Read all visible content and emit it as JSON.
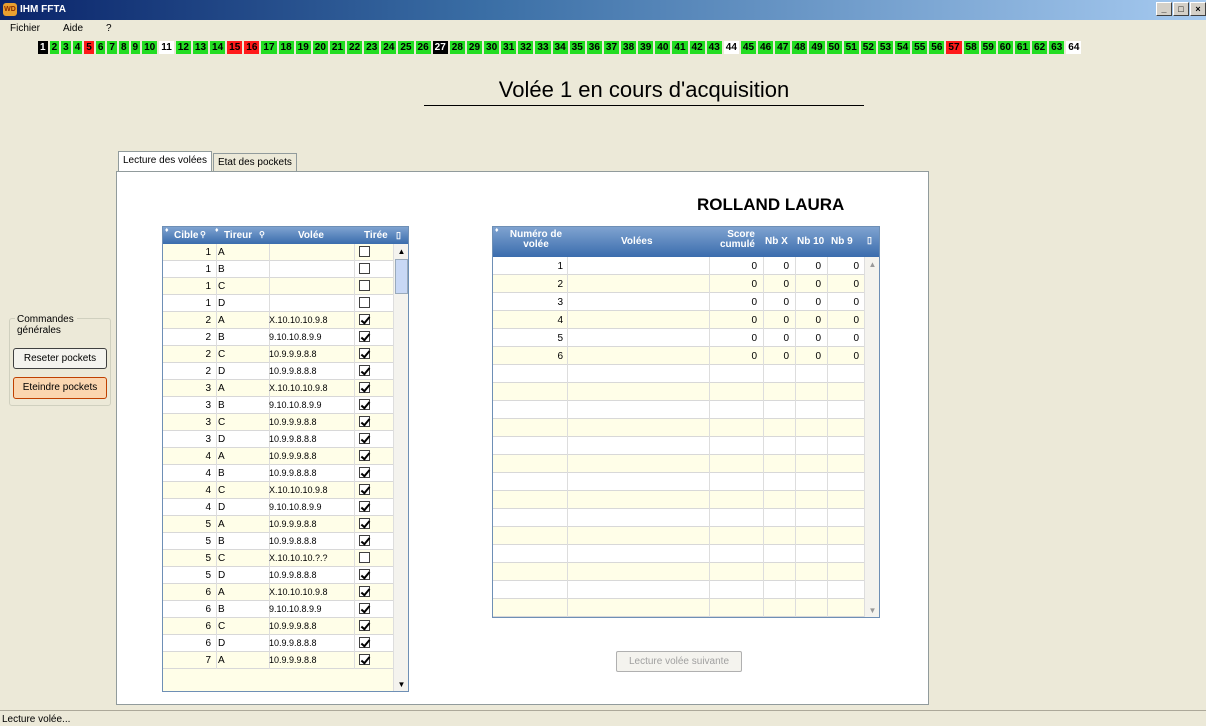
{
  "window": {
    "title": "IHM FFTA",
    "icon_text": "WD"
  },
  "menu": [
    "Fichier",
    "Aide",
    "?"
  ],
  "targets": [
    {
      "n": "1",
      "s": "black"
    },
    {
      "n": "2",
      "s": "green"
    },
    {
      "n": "3",
      "s": "green"
    },
    {
      "n": "4",
      "s": "green"
    },
    {
      "n": "5",
      "s": "red"
    },
    {
      "n": "6",
      "s": "green"
    },
    {
      "n": "7",
      "s": "green"
    },
    {
      "n": "8",
      "s": "green"
    },
    {
      "n": "9",
      "s": "green"
    },
    {
      "n": "10",
      "s": "green"
    },
    {
      "n": "11",
      "s": "white"
    },
    {
      "n": "12",
      "s": "green"
    },
    {
      "n": "13",
      "s": "green"
    },
    {
      "n": "14",
      "s": "green"
    },
    {
      "n": "15",
      "s": "red"
    },
    {
      "n": "16",
      "s": "red"
    },
    {
      "n": "17",
      "s": "green"
    },
    {
      "n": "18",
      "s": "green"
    },
    {
      "n": "19",
      "s": "green"
    },
    {
      "n": "20",
      "s": "green"
    },
    {
      "n": "21",
      "s": "green"
    },
    {
      "n": "22",
      "s": "green"
    },
    {
      "n": "23",
      "s": "green"
    },
    {
      "n": "24",
      "s": "green"
    },
    {
      "n": "25",
      "s": "green"
    },
    {
      "n": "26",
      "s": "green"
    },
    {
      "n": "27",
      "s": "black"
    },
    {
      "n": "28",
      "s": "green"
    },
    {
      "n": "29",
      "s": "green"
    },
    {
      "n": "30",
      "s": "green"
    },
    {
      "n": "31",
      "s": "green"
    },
    {
      "n": "32",
      "s": "green"
    },
    {
      "n": "33",
      "s": "green"
    },
    {
      "n": "34",
      "s": "green"
    },
    {
      "n": "35",
      "s": "green"
    },
    {
      "n": "36",
      "s": "green"
    },
    {
      "n": "37",
      "s": "green"
    },
    {
      "n": "38",
      "s": "green"
    },
    {
      "n": "39",
      "s": "green"
    },
    {
      "n": "40",
      "s": "green"
    },
    {
      "n": "41",
      "s": "green"
    },
    {
      "n": "42",
      "s": "green"
    },
    {
      "n": "43",
      "s": "green"
    },
    {
      "n": "44",
      "s": "white"
    },
    {
      "n": "45",
      "s": "green"
    },
    {
      "n": "46",
      "s": "green"
    },
    {
      "n": "47",
      "s": "green"
    },
    {
      "n": "48",
      "s": "green"
    },
    {
      "n": "49",
      "s": "green"
    },
    {
      "n": "50",
      "s": "green"
    },
    {
      "n": "51",
      "s": "green"
    },
    {
      "n": "52",
      "s": "green"
    },
    {
      "n": "53",
      "s": "green"
    },
    {
      "n": "54",
      "s": "green"
    },
    {
      "n": "55",
      "s": "green"
    },
    {
      "n": "56",
      "s": "green"
    },
    {
      "n": "57",
      "s": "red"
    },
    {
      "n": "58",
      "s": "green"
    },
    {
      "n": "59",
      "s": "green"
    },
    {
      "n": "60",
      "s": "green"
    },
    {
      "n": "61",
      "s": "green"
    },
    {
      "n": "62",
      "s": "green"
    },
    {
      "n": "63",
      "s": "green"
    },
    {
      "n": "64",
      "s": "white"
    }
  ],
  "headline": "Volée 1 en cours d'acquisition",
  "tabs": [
    "Lecture des volées",
    "Etat des pockets"
  ],
  "archer_name": "ROLLAND LAURA",
  "grid1": {
    "headers": {
      "cible": "Cible",
      "tireur": "Tireur",
      "volee": "Volée",
      "tiree": "Tirée"
    },
    "rows": [
      {
        "cible": "1",
        "tireur": "A",
        "volee": "",
        "tiree": false
      },
      {
        "cible": "1",
        "tireur": "B",
        "volee": "",
        "tiree": false
      },
      {
        "cible": "1",
        "tireur": "C",
        "volee": "",
        "tiree": false
      },
      {
        "cible": "1",
        "tireur": "D",
        "volee": "",
        "tiree": false
      },
      {
        "cible": "2",
        "tireur": "A",
        "volee": "X.10.10.10.9.8",
        "tiree": true
      },
      {
        "cible": "2",
        "tireur": "B",
        "volee": "9.10.10.8.9.9",
        "tiree": true
      },
      {
        "cible": "2",
        "tireur": "C",
        "volee": "10.9.9.9.8.8",
        "tiree": true
      },
      {
        "cible": "2",
        "tireur": "D",
        "volee": "10.9.9.8.8.8",
        "tiree": true
      },
      {
        "cible": "3",
        "tireur": "A",
        "volee": "X.10.10.10.9.8",
        "tiree": true
      },
      {
        "cible": "3",
        "tireur": "B",
        "volee": "9.10.10.8.9.9",
        "tiree": true
      },
      {
        "cible": "3",
        "tireur": "C",
        "volee": "10.9.9.9.8.8",
        "tiree": true
      },
      {
        "cible": "3",
        "tireur": "D",
        "volee": "10.9.9.8.8.8",
        "tiree": true
      },
      {
        "cible": "4",
        "tireur": "A",
        "volee": "10.9.9.9.8.8",
        "tiree": true
      },
      {
        "cible": "4",
        "tireur": "B",
        "volee": "10.9.9.8.8.8",
        "tiree": true
      },
      {
        "cible": "4",
        "tireur": "C",
        "volee": "X.10.10.10.9.8",
        "tiree": true
      },
      {
        "cible": "4",
        "tireur": "D",
        "volee": "9.10.10.8.9.9",
        "tiree": true
      },
      {
        "cible": "5",
        "tireur": "A",
        "volee": "10.9.9.9.8.8",
        "tiree": true
      },
      {
        "cible": "5",
        "tireur": "B",
        "volee": "10.9.9.8.8.8",
        "tiree": true
      },
      {
        "cible": "5",
        "tireur": "C",
        "volee": "X.10.10.10.?.?",
        "tiree": false
      },
      {
        "cible": "5",
        "tireur": "D",
        "volee": "10.9.9.8.8.8",
        "tiree": true
      },
      {
        "cible": "6",
        "tireur": "A",
        "volee": "X.10.10.10.9.8",
        "tiree": true
      },
      {
        "cible": "6",
        "tireur": "B",
        "volee": "9.10.10.8.9.9",
        "tiree": true
      },
      {
        "cible": "6",
        "tireur": "C",
        "volee": "10.9.9.9.8.8",
        "tiree": true
      },
      {
        "cible": "6",
        "tireur": "D",
        "volee": "10.9.9.8.8.8",
        "tiree": true
      },
      {
        "cible": "7",
        "tireur": "A",
        "volee": "10.9.9.9.8.8",
        "tiree": true
      }
    ]
  },
  "grid2": {
    "headers": {
      "numero": "Numéro de volée",
      "volees": "Volées",
      "score": "Score cumulé",
      "nbx": "Nb X",
      "nb10": "Nb 10",
      "nb9": "Nb 9"
    },
    "rows": [
      {
        "numero": "1",
        "volees": "",
        "score": "0",
        "nbx": "0",
        "nb10": "0",
        "nb9": "0"
      },
      {
        "numero": "2",
        "volees": "",
        "score": "0",
        "nbx": "0",
        "nb10": "0",
        "nb9": "0"
      },
      {
        "numero": "3",
        "volees": "",
        "score": "0",
        "nbx": "0",
        "nb10": "0",
        "nb9": "0"
      },
      {
        "numero": "4",
        "volees": "",
        "score": "0",
        "nbx": "0",
        "nb10": "0",
        "nb9": "0"
      },
      {
        "numero": "5",
        "volees": "",
        "score": "0",
        "nbx": "0",
        "nb10": "0",
        "nb9": "0"
      },
      {
        "numero": "6",
        "volees": "",
        "score": "0",
        "nbx": "0",
        "nb10": "0",
        "nb9": "0"
      }
    ],
    "empty_rows": 14
  },
  "next_button": "Lecture volée suivante",
  "commands": {
    "label": "Commandes générales",
    "reset": "Reseter pockets",
    "off": "Eteindre pockets"
  },
  "status": "Lecture volée..."
}
